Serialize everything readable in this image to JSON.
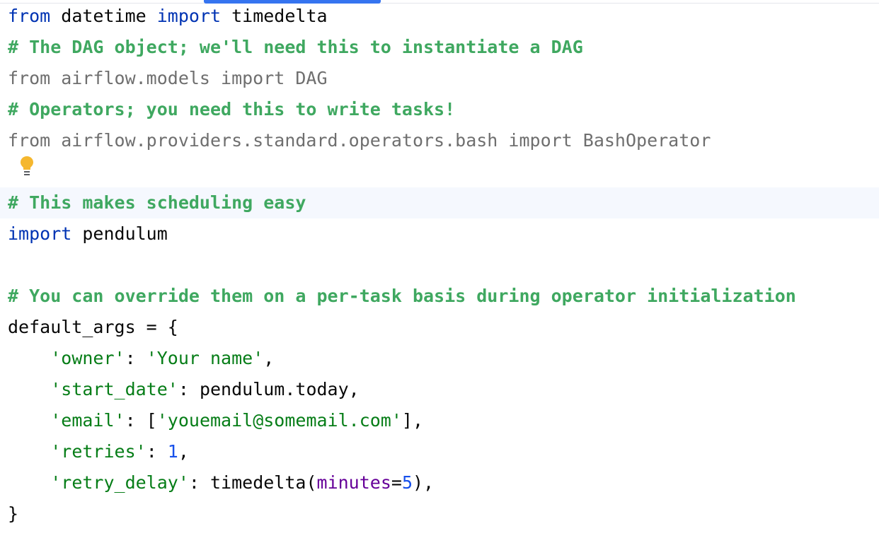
{
  "editor": {
    "lines": [
      [
        {
          "t": "from",
          "c": "kw"
        },
        {
          "t": " datetime ",
          "c": "plain"
        },
        {
          "t": "import",
          "c": "kw"
        },
        {
          "t": " timedelta",
          "c": "plain"
        }
      ],
      [
        {
          "t": "# The DAG object; we'll need this to instantiate a DAG",
          "c": "comment"
        }
      ],
      [
        {
          "t": "from airflow.models import DAG",
          "c": "unused"
        }
      ],
      [
        {
          "t": "# Operators; you need this to write tasks!",
          "c": "comment"
        }
      ],
      [
        {
          "t": "from airflow.providers.standard.operators.bash import BashOperator",
          "c": "unused"
        }
      ],
      [],
      [
        {
          "t": "# This makes scheduling easy",
          "c": "comment"
        }
      ],
      [
        {
          "t": "import",
          "c": "kw"
        },
        {
          "t": " pendulum",
          "c": "plain"
        }
      ],
      [],
      [
        {
          "t": "# You can override them on a per-task basis during operator initialization",
          "c": "comment"
        }
      ],
      [
        {
          "t": "default_args = {",
          "c": "plain"
        }
      ],
      [
        {
          "t": "    ",
          "c": "plain"
        },
        {
          "t": "'owner'",
          "c": "str"
        },
        {
          "t": ": ",
          "c": "plain"
        },
        {
          "t": "'Your name'",
          "c": "str"
        },
        {
          "t": ",",
          "c": "plain"
        }
      ],
      [
        {
          "t": "    ",
          "c": "plain"
        },
        {
          "t": "'start_date'",
          "c": "str"
        },
        {
          "t": ": pendulum.today,",
          "c": "plain"
        }
      ],
      [
        {
          "t": "    ",
          "c": "plain"
        },
        {
          "t": "'email'",
          "c": "str"
        },
        {
          "t": ": [",
          "c": "plain"
        },
        {
          "t": "'youemail@somemail.com'",
          "c": "str"
        },
        {
          "t": "],",
          "c": "plain"
        }
      ],
      [
        {
          "t": "    ",
          "c": "plain"
        },
        {
          "t": "'retries'",
          "c": "str"
        },
        {
          "t": ": ",
          "c": "plain"
        },
        {
          "t": "1",
          "c": "num"
        },
        {
          "t": ",",
          "c": "plain"
        }
      ],
      [
        {
          "t": "    ",
          "c": "plain"
        },
        {
          "t": "'retry_delay'",
          "c": "str"
        },
        {
          "t": ": timedelta(",
          "c": "plain"
        },
        {
          "t": "minutes",
          "c": "param"
        },
        {
          "t": "=",
          "c": "plain"
        },
        {
          "t": "5",
          "c": "num"
        },
        {
          "t": "),",
          "c": "plain"
        }
      ],
      [
        {
          "t": "}",
          "c": "plain"
        }
      ]
    ],
    "caret_line_index": 6,
    "intention_icon": "lightbulb-icon"
  },
  "colors": {
    "keyword": "#0033b3",
    "comment": "#3fa860",
    "string": "#067d17",
    "number": "#1750eb",
    "unused_import": "#6f6f6f",
    "named_param": "#660099",
    "caret_line_bg": "#f5f8fe",
    "tab_indicator": "#3574f0"
  }
}
